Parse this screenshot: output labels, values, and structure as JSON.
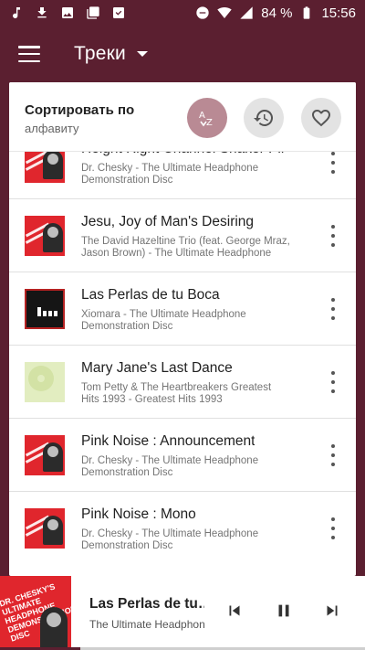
{
  "status_bar": {
    "battery_percent": "84 %",
    "time": "15:56",
    "left_icons": [
      "music-note-icon",
      "download-icon",
      "image-icon",
      "gallery-icon",
      "inbox-icon"
    ],
    "right_icons": [
      "do-not-disturb-icon",
      "wifi-icon",
      "signal-icon",
      "battery-icon"
    ]
  },
  "app_bar": {
    "title": "Треки",
    "menu_icon": "hamburger-menu-icon",
    "dropdown_icon": "caret-down-icon"
  },
  "sort": {
    "label": "Сортировать по",
    "value": "алфавиту",
    "buttons": [
      {
        "name": "sort-alphabet",
        "icon": "az-sort-icon",
        "active": true
      },
      {
        "name": "sort-recent",
        "icon": "history-icon",
        "active": false
      },
      {
        "name": "sort-favorite",
        "icon": "heart-outline-icon",
        "active": false
      }
    ]
  },
  "tracks": [
    {
      "title": "Height Right Channel Shaker Pil",
      "subtitle": "Dr. Chesky - The Ultimate Headphone Demonstration Disc",
      "art": "red"
    },
    {
      "title": "Jesu, Joy of Man's Desiring",
      "subtitle": "The David Hazeltine Trio (feat. George Mraz, Jason Brown) - The Ultimate Headphone De…",
      "art": "red"
    },
    {
      "title": "Las Perlas de tu Boca",
      "subtitle": "Xiomara - The Ultimate Headphone Demonstration Disc",
      "art": "dark"
    },
    {
      "title": "Mary Jane's Last Dance",
      "subtitle": "Tom Petty & The Heartbreakers Greatest Hits 1993 - Greatest Hits 1993",
      "art": "light"
    },
    {
      "title": "Pink Noise : Announcement",
      "subtitle": "Dr. Chesky - The Ultimate Headphone Demonstration Disc",
      "art": "red"
    },
    {
      "title": "Pink Noise : Mono",
      "subtitle": "Dr. Chesky - The Ultimate Headphone Demonstration Disc",
      "art": "red"
    }
  ],
  "player": {
    "title": "Las Perlas de tu…",
    "subtitle": "The Ultimate Headphon…",
    "art_text": "Dr. Chesky's Ultimate Headphone Demonstration Disc",
    "progress": 0.22,
    "prev_icon": "skip-previous-icon",
    "pause_icon": "pause-icon",
    "next_icon": "skip-next-icon"
  },
  "colors": {
    "primary": "#5b1f30",
    "accent_button": "#b98a94",
    "album_red": "#e0262d"
  }
}
